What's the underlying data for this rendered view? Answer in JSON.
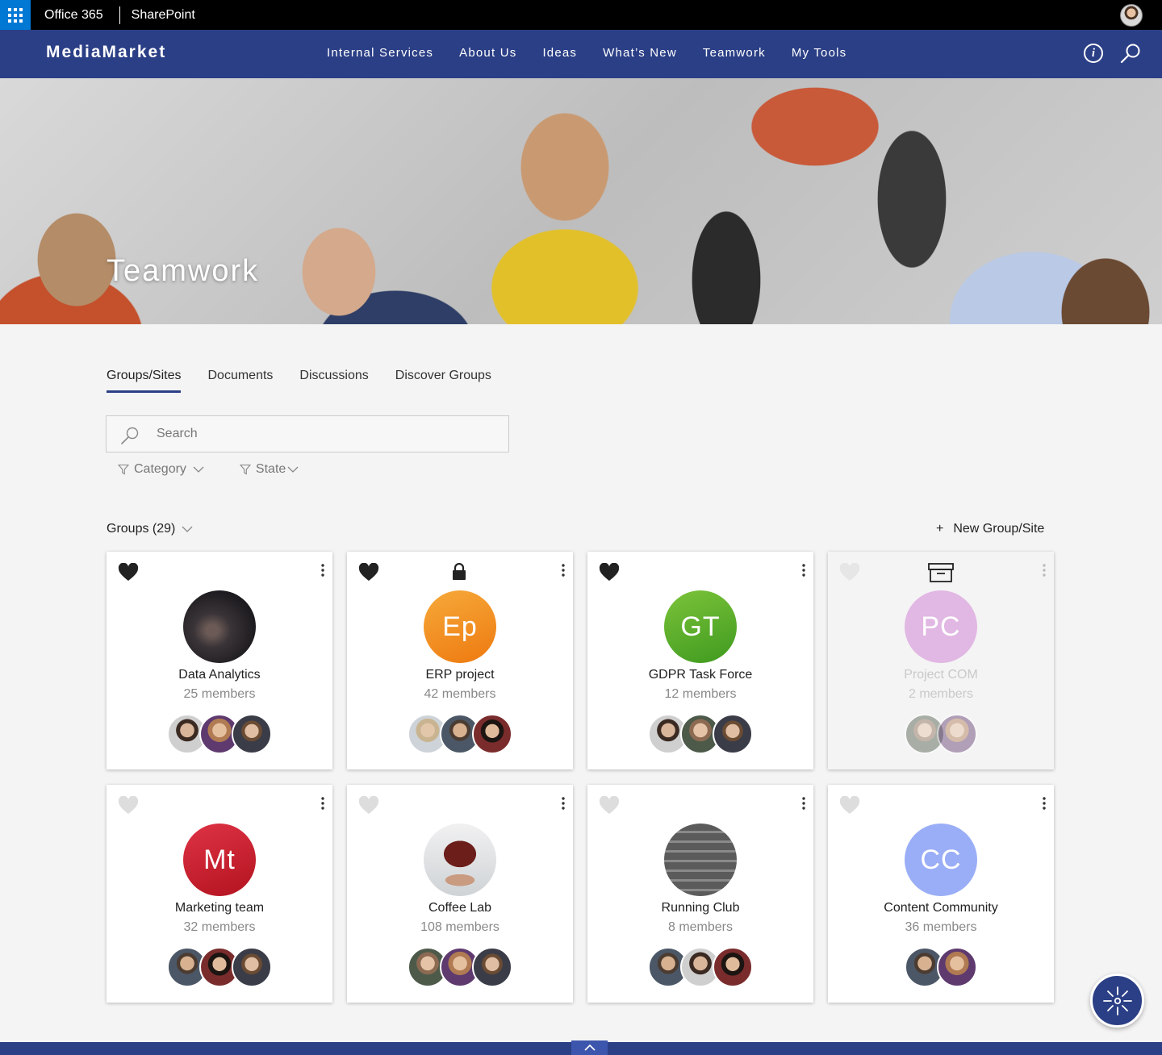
{
  "suite_bar": {
    "waffle_icon": "app-launcher-icon",
    "app_name": "Office 365",
    "product": "SharePoint"
  },
  "nav": {
    "brand": "MediaMarket",
    "links": [
      "Internal Services",
      "About Us",
      "Ideas",
      "What’s New",
      "Teamwork",
      "My Tools"
    ],
    "info_icon": "info-icon",
    "search_icon": "search-icon"
  },
  "hero": {
    "title": "Teamwork"
  },
  "tabs": [
    "Groups/Sites",
    "Documents",
    "Discussions",
    "Discover Groups"
  ],
  "active_tab": "Groups/Sites",
  "search": {
    "placeholder": "Search",
    "value": ""
  },
  "filters": [
    "Category",
    "State"
  ],
  "groups": {
    "heading": "Groups (29)",
    "new_label": "New Group/Site",
    "new_icon": "+",
    "cards": [
      {
        "title": "Data Analytics",
        "members": "25 members",
        "initials": "",
        "favorite": true,
        "badge": "",
        "dim": false
      },
      {
        "title": "ERP project",
        "members": "42 members",
        "initials": "Ep",
        "favorite": true,
        "badge": "lock-icon",
        "dim": false
      },
      {
        "title": "GDPR Task Force",
        "members": "12 members",
        "initials": "GT",
        "favorite": true,
        "badge": "",
        "dim": false
      },
      {
        "title": "Project COM",
        "members": "2 members",
        "initials": "PC",
        "favorite": false,
        "badge": "archive-icon",
        "dim": true
      },
      {
        "title": "Marketing team",
        "members": "32 members",
        "initials": "Mt",
        "favorite": false,
        "badge": "",
        "dim": false
      },
      {
        "title": "Coffee Lab",
        "members": "108 members",
        "initials": "",
        "favorite": false,
        "badge": "",
        "dim": false
      },
      {
        "title": "Running Club",
        "members": "8 members",
        "initials": "",
        "favorite": false,
        "badge": "",
        "dim": false
      },
      {
        "title": "Content Community",
        "members": "36 members",
        "initials": "CC",
        "favorite": false,
        "badge": "",
        "dim": false
      }
    ]
  },
  "colors": {
    "nav": "#2b3f86",
    "accent": "#0078d4",
    "ep": "#f28a20",
    "gt": "#5cab2a",
    "pc": "#e1b7e3",
    "mt": "#c8202f",
    "cc": "#9aaef7"
  }
}
